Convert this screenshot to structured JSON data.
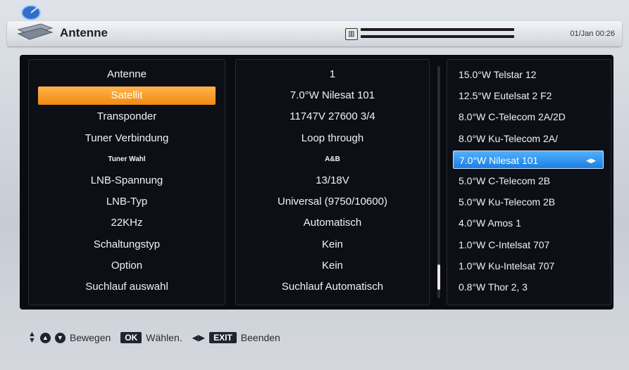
{
  "header": {
    "title": "Antenne",
    "date": "01/Jan 00:26",
    "signal_icon": "signal-box-icon"
  },
  "labels": [
    "Antenne",
    "Satellit",
    "Transponder",
    "Tuner Verbindung",
    "Tuner Wahl",
    "LNB-Spannung",
    "LNB-Typ",
    "22KHz",
    "Schaltungstyp",
    "Option",
    "Suchlauf auswahl"
  ],
  "values": [
    "1",
    "7.0°W Nilesat 101",
    "11747V 27600 3/4",
    "Loop through",
    "A&B",
    "13/18V",
    "Universal (9750/10600)",
    "Automatisch",
    "Kein",
    "Kein",
    "Suchlauf Automatisch"
  ],
  "satellites": [
    "15.0°W Telstar 12",
    "12.5°W Eutelsat 2 F2",
    "8.0°W C-Telecom 2A/2D",
    "8.0°W Ku-Telecom 2A/",
    "7.0°W Nilesat 101",
    "5.0°W C-Telecom 2B",
    "5.0°W Ku-Telecom 2B",
    "4.0°W Amos 1",
    "1.0°W C-Intelsat 707",
    "1.0°W Ku-Intelsat 707",
    "0.8°W Thor 2, 3"
  ],
  "selected_label_index": 1,
  "selected_satellite_index": 4,
  "footer": {
    "move": "Bewegen",
    "ok_key": "OK",
    "select": "Wählen.",
    "exit_key": "EXIT",
    "quit": "Beenden"
  },
  "colors": {
    "selection_orange": "#f59a20",
    "selection_blue": "#2a8cf0",
    "panel_bg": "#0d0f16"
  }
}
